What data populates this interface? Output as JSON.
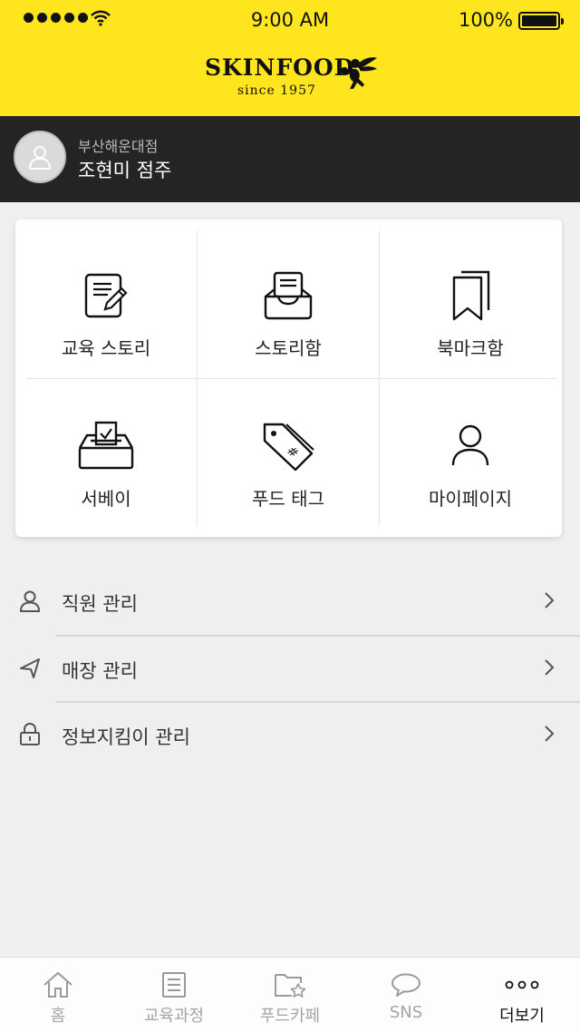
{
  "status_bar": {
    "time": "9:00 AM",
    "battery": "100%"
  },
  "logo": {
    "brand": "SKINFOOD",
    "since": "since 1957"
  },
  "profile": {
    "store": "부산해운대점",
    "name": "조현미 점주"
  },
  "grid": [
    {
      "label": "교육 스토리",
      "icon": "document-edit-icon"
    },
    {
      "label": "스토리함",
      "icon": "inbox-tray-icon"
    },
    {
      "label": "북마크함",
      "icon": "bookmarks-icon"
    },
    {
      "label": "서베이",
      "icon": "ballot-box-icon"
    },
    {
      "label": "푸드 태그",
      "icon": "price-tag-icon"
    },
    {
      "label": "마이페이지",
      "icon": "user-icon"
    }
  ],
  "menu": [
    {
      "label": "직원 관리",
      "icon": "person-icon"
    },
    {
      "label": "매장 관리",
      "icon": "navigation-arrow-icon"
    },
    {
      "label": "정보지킴이 관리",
      "icon": "lock-icon"
    }
  ],
  "tabs": [
    {
      "label": "홈",
      "icon": "home-icon"
    },
    {
      "label": "교육과정",
      "icon": "document-list-icon"
    },
    {
      "label": "푸드카페",
      "icon": "folder-star-icon"
    },
    {
      "label": "SNS",
      "icon": "chat-bubble-icon"
    },
    {
      "label": "더보기",
      "icon": "more-dots-icon",
      "active": true
    }
  ],
  "colors": {
    "brand_yellow": "#ffe51e",
    "profile_bg": "#242424",
    "page_bg": "#efefef"
  }
}
